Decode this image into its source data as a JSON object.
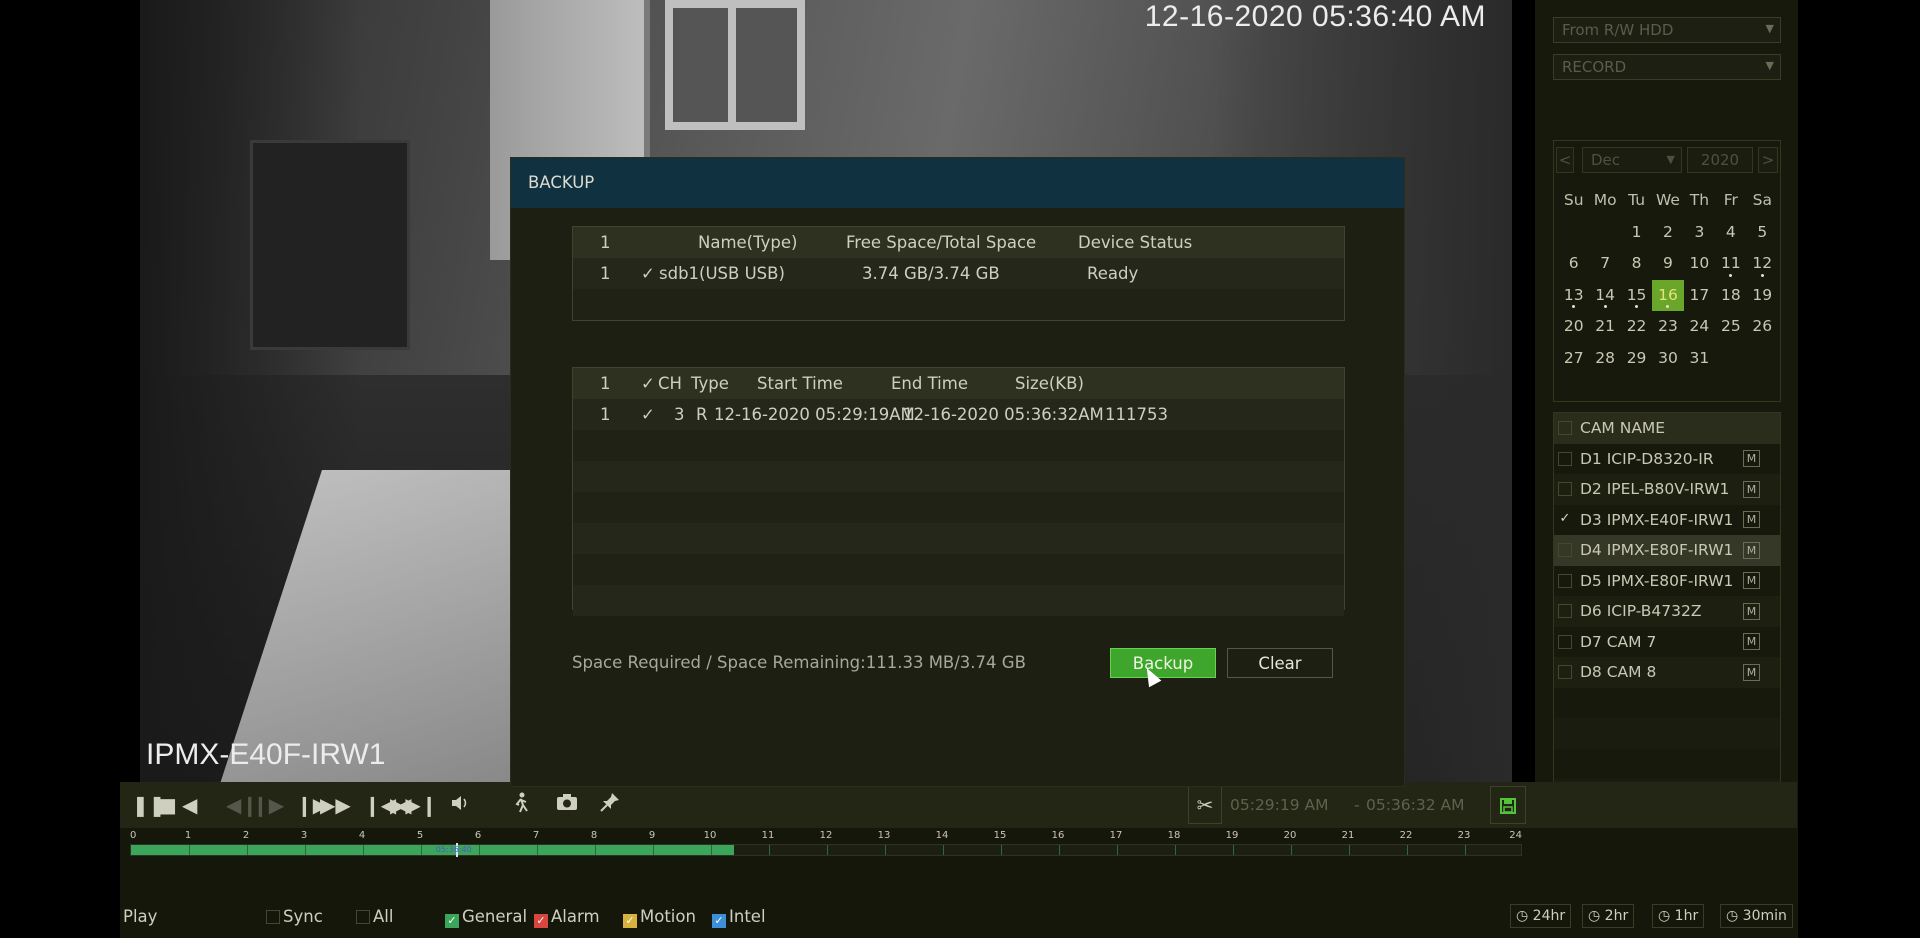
{
  "camera": {
    "timestamp": "12-16-2020 05:36:40 AM",
    "label": "IPMX-E40F-IRW1"
  },
  "right_panel": {
    "source_dropdown": "From R/W HDD",
    "type_dropdown": "RECORD",
    "calendar": {
      "prev": "<",
      "next": ">",
      "month": "Dec",
      "year": "2020",
      "weekdays": [
        "Su",
        "Mo",
        "Tu",
        "We",
        "Th",
        "Fr",
        "Sa"
      ],
      "weeks": [
        [
          "",
          "",
          "1",
          "2",
          "3",
          "4",
          "5"
        ],
        [
          "6",
          "7",
          "8",
          "9",
          "10",
          "11",
          "12"
        ],
        [
          "13",
          "14",
          "15",
          "16",
          "17",
          "18",
          "19"
        ],
        [
          "20",
          "21",
          "22",
          "23",
          "24",
          "25",
          "26"
        ],
        [
          "27",
          "28",
          "29",
          "30",
          "31",
          "",
          ""
        ]
      ],
      "selected_day": "16",
      "days_with_records": [
        "11",
        "12",
        "13",
        "14",
        "15",
        "16"
      ]
    },
    "cam_list": {
      "header": "CAM NAME",
      "cameras": [
        {
          "name": "D1 ICIP-D8320-IR",
          "checked": false,
          "badge": "M"
        },
        {
          "name": "D2 IPEL-B80V-IRW1",
          "checked": false,
          "badge": "M"
        },
        {
          "name": "D3 IPMX-E40F-IRW1",
          "checked": true,
          "badge": "M"
        },
        {
          "name": "D4 IPMX-E80F-IRW1",
          "checked": false,
          "badge": "M"
        },
        {
          "name": "D5 IPMX-E80F-IRW1",
          "checked": false,
          "badge": "M"
        },
        {
          "name": "D6 ICIP-B4732Z",
          "checked": false,
          "badge": "M"
        },
        {
          "name": "D7 CAM 7",
          "checked": false,
          "badge": "M"
        },
        {
          "name": "D8 CAM 8",
          "checked": false,
          "badge": "M"
        }
      ]
    },
    "view_buttons": [
      "search-face-icon",
      "list-icon",
      "fullscreen-icon"
    ]
  },
  "toolbar": {
    "clip_start": "05:29:19 AM",
    "clip_sep": "-",
    "clip_end": "05:36:32 AM"
  },
  "timeline": {
    "hours": [
      "0",
      "1",
      "2",
      "3",
      "4",
      "5",
      "6",
      "7",
      "8",
      "9",
      "10",
      "11",
      "12",
      "13",
      "14",
      "15",
      "16",
      "17",
      "18",
      "19",
      "20",
      "21",
      "22",
      "23",
      "24"
    ],
    "recorded_until_hour": 10.4,
    "cursor_hour": 5.6,
    "cursor_label": "05:36:40"
  },
  "status": {
    "mode": "Play",
    "sync": "Sync",
    "all": "All",
    "general": "General",
    "alarm": "Alarm",
    "motion": "Motion",
    "intel": "Intel",
    "colors": {
      "general": "#3aa55b",
      "alarm": "#d8473e",
      "motion": "#d8b23e",
      "intel": "#3e8ed8"
    },
    "scales": [
      "24hr",
      "2hr",
      "1hr",
      "30min"
    ]
  },
  "dialog": {
    "title": "BACKUP",
    "device_table": {
      "headers": [
        "1",
        "Name(Type)",
        "Free Space/Total Space",
        "Device Status"
      ],
      "rows": [
        {
          "index": "1",
          "check": "✓",
          "name": "sdb1(USB USB)",
          "space": "3.74 GB/3.74 GB",
          "status": "Ready"
        }
      ]
    },
    "file_table": {
      "headers": [
        "1",
        "✓",
        "CH",
        "Type",
        "Start Time",
        "End Time",
        "Size(KB)"
      ],
      "rows": [
        {
          "index": "1",
          "check": "✓",
          "ch": "3",
          "type": "R",
          "start": "12-16-2020 05:29:19AM",
          "end": "12-16-2020 05:36:32AM",
          "size": "111753"
        }
      ]
    },
    "space_info": "Space Required / Space Remaining:111.33 MB/3.74 GB",
    "backup_label": "Backup",
    "clear_label": "Clear"
  }
}
